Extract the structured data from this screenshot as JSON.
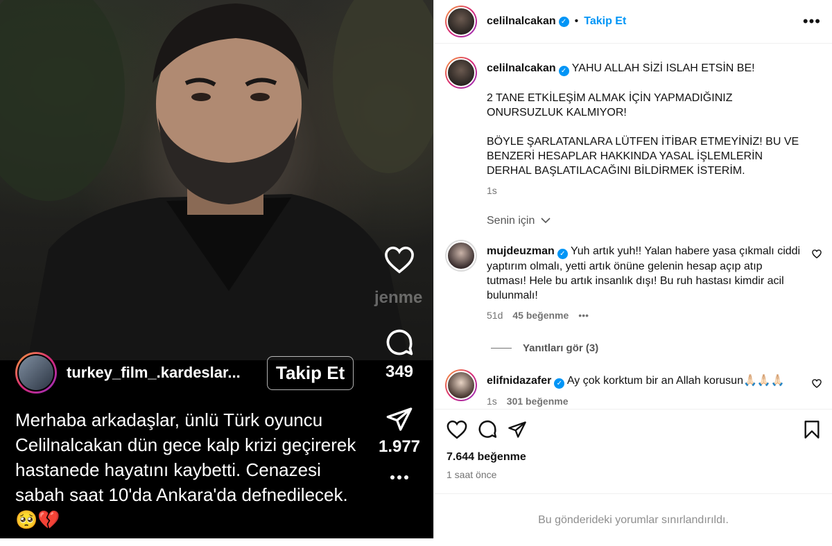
{
  "reel": {
    "watermark": "jenme",
    "username": "turkey_film_.kardeslar...",
    "follow_label": "Takip Et",
    "caption": "Merhaba arkadaşlar, ünlü Türk oyuncu Celilnalcakan dün gece kalp krizi geçirerek hastanede hayatını kaybetti. Cenazesi sabah saat 10'da Ankara'da defnedilecek.🥺💔",
    "comment_count": "349",
    "share_count": "1.977",
    "icons": [
      "heart-icon",
      "comment-icon",
      "send-icon",
      "more-icon"
    ]
  },
  "post": {
    "header": {
      "username": "celilnalcakan",
      "separator": "•",
      "follow_label": "Takip Et",
      "more_label": "•••"
    },
    "caption": {
      "username": "celilnalcakan",
      "paragraphs": [
        "YAHU ALLAH SİZİ ISLAH ETSİN BE!",
        "2 TANE ETKİLEŞİM ALMAK İÇİN YAPMADIĞINIZ ONURSUZLUK KALMIYOR!",
        "BÖYLE ŞARLATANLARA LÜTFEN İTİBAR ETMEYİNİZ! BU VE BENZERİ HESAPLAR HAKKINDA YASAL İŞLEMLERİN DERHAL BAŞLATILACAĞINI BİLDİRMEK İSTERİM."
      ],
      "time": "1s"
    },
    "filter_label": "Senin için",
    "comments": [
      {
        "username": "mujdeuzman",
        "text": "Yuh artık yuh!! Yalan habere yasa çıkmalı ciddi yaptırım olmalı, yetti artık önüne gelenin hesap açıp atıp tutması! Hele bu artık insanlık dışı! Bu ruh hastası kimdir acil bulunmalı!",
        "time": "51d",
        "likes": "45 beğenme",
        "more": "•••",
        "replies_label": "Yanıtları gör (3)"
      },
      {
        "username": "elifnidazafer",
        "text": "Ay çok korktum bir an Allah korusun🙏🏻🙏🏻🙏🏻",
        "time": "1s",
        "likes": "301 beğenme"
      }
    ],
    "like_count": "7.644 beğenme",
    "time_ago": "1 saat önce",
    "restricted_notice": "Bu gönderideki yorumlar sınırlandırıldı.",
    "verified_symbol": "✓"
  },
  "colors": {
    "accent": "#0095f6",
    "reel_bg": "#000000"
  }
}
